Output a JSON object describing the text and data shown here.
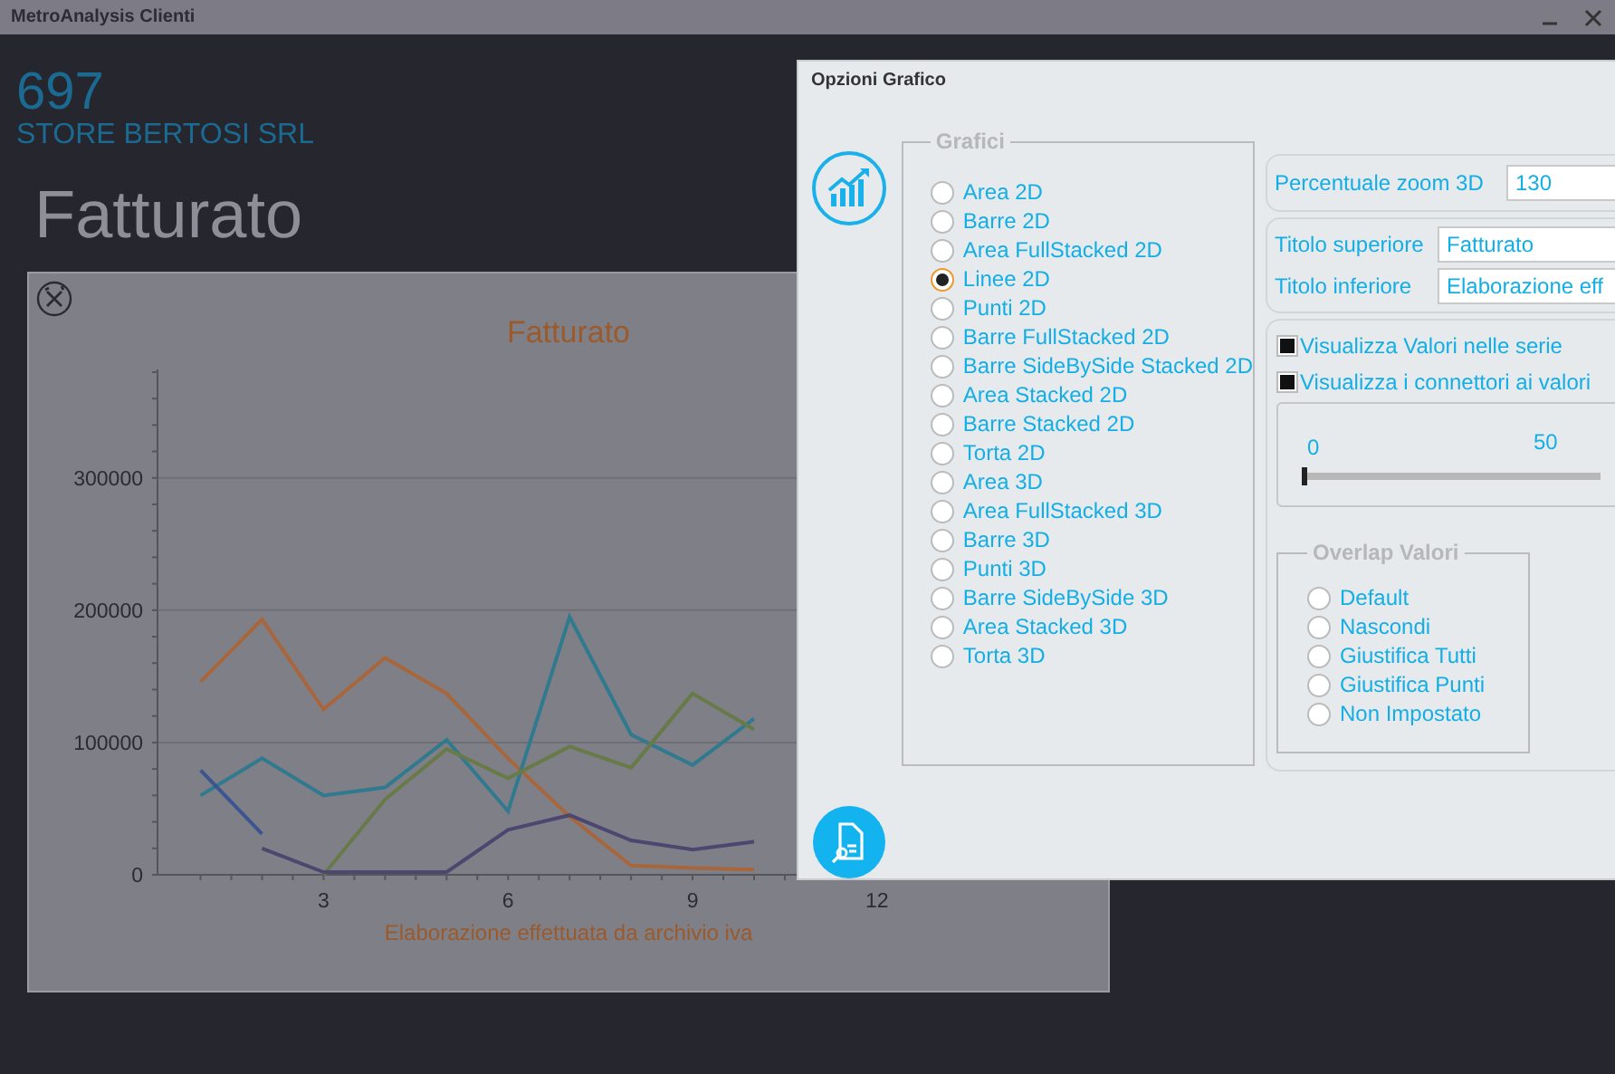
{
  "window": {
    "title": "MetroAnalysis Clienti"
  },
  "header": {
    "code": "697",
    "client": "STORE BERTOSI SRL",
    "page_title": "Fatturato"
  },
  "chart": {
    "chart_data": {
      "type": "line",
      "title": "Fatturato",
      "xlabel": "Elaborazione effettuata da archivio iva",
      "xlim": [
        0.3,
        12.9
      ],
      "ylim": [
        0,
        382000
      ],
      "grid": true,
      "xticks": [
        3,
        6,
        9,
        12
      ],
      "yticks": [
        0,
        100000,
        200000,
        300000
      ],
      "x": [
        1,
        2,
        3,
        4,
        5,
        6,
        7,
        8,
        9,
        10
      ],
      "series": [
        {
          "color": "#a8663c",
          "values": [
            146000,
            193000,
            125000,
            164000,
            137000,
            88000,
            44000,
            7000,
            5000,
            4000
          ]
        },
        {
          "color": "#2f7a8e",
          "values": [
            60000,
            88000,
            60000,
            66000,
            102000,
            48000,
            195000,
            106000,
            83000,
            118000
          ]
        },
        {
          "color": "#677a48",
          "values": [
            null,
            null,
            0,
            57000,
            95000,
            73000,
            97000,
            81000,
            137000,
            110000
          ]
        },
        {
          "color": "#4c4670",
          "values": [
            null,
            20000,
            2000,
            2000,
            2000,
            34000,
            45000,
            26000,
            19000,
            25000
          ]
        },
        {
          "color": "#3b5590",
          "values": [
            79000,
            31000,
            null,
            null,
            null,
            null,
            null,
            null,
            null,
            null
          ]
        }
      ]
    }
  },
  "dialog": {
    "title": "Opzioni Grafico",
    "chart_types": {
      "legend": "Grafici",
      "options": [
        {
          "label": "Area 2D",
          "selected": false
        },
        {
          "label": "Barre 2D",
          "selected": false
        },
        {
          "label": "Area FullStacked 2D",
          "selected": false
        },
        {
          "label": "Linee 2D",
          "selected": true
        },
        {
          "label": "Punti 2D",
          "selected": false
        },
        {
          "label": "Barre FullStacked 2D",
          "selected": false
        },
        {
          "label": "Barre SideBySide Stacked 2D",
          "selected": false
        },
        {
          "label": "Area Stacked 2D",
          "selected": false
        },
        {
          "label": "Barre Stacked 2D",
          "selected": false
        },
        {
          "label": "Torta 2D",
          "selected": false
        },
        {
          "label": "Area 3D",
          "selected": false
        },
        {
          "label": "Area FullStacked 3D",
          "selected": false
        },
        {
          "label": "Barre 3D",
          "selected": false
        },
        {
          "label": "Punti 3D",
          "selected": false
        },
        {
          "label": "Barre SideBySide 3D",
          "selected": false
        },
        {
          "label": "Area Stacked 3D",
          "selected": false
        },
        {
          "label": "Torta 3D",
          "selected": false
        }
      ]
    },
    "zoom": {
      "label": "Percentuale zoom 3D",
      "value": "130"
    },
    "titles": [
      {
        "label": "Titolo superiore",
        "value": "Fatturato"
      },
      {
        "label": "Titolo inferiore",
        "value": "Elaborazione eff"
      }
    ],
    "checkboxes": [
      {
        "label": "Visualizza Valori nelle serie",
        "checked": true
      },
      {
        "label": "Visualizza i connettori ai valori",
        "checked": true
      }
    ],
    "slider": {
      "ticks": [
        "0",
        "50"
      ],
      "level": 0
    },
    "overlap": {
      "legend": "Overlap Valori",
      "options": [
        {
          "label": "Default",
          "selected": false
        },
        {
          "label": "Nascondi",
          "selected": false
        },
        {
          "label": "Giustifica Tutti",
          "selected": false
        },
        {
          "label": "Giustifica Punti",
          "selected": false
        },
        {
          "label": "Non Impostato",
          "selected": false
        }
      ]
    }
  }
}
